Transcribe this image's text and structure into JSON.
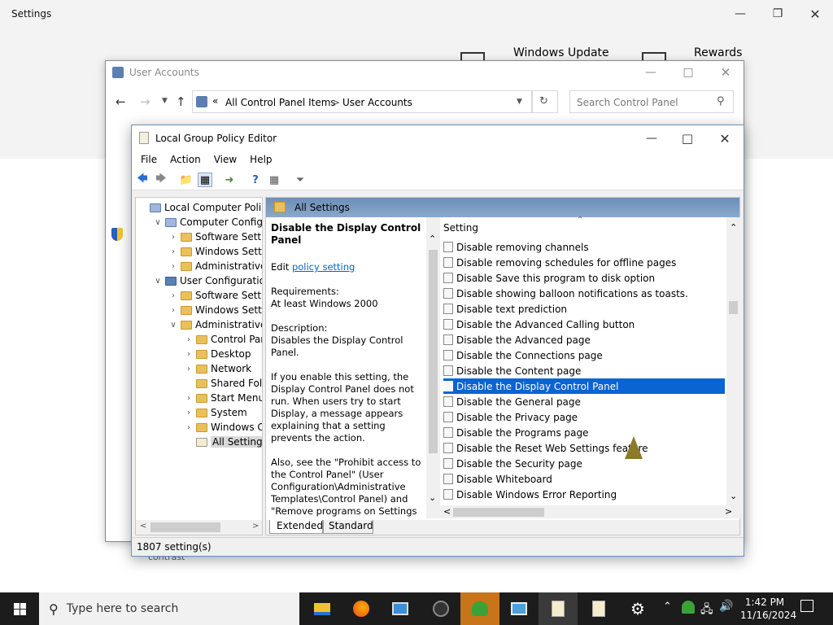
{
  "settings": {
    "title": "Settings",
    "tiles": [
      "Windows Update",
      "Rewards"
    ],
    "bottom_text": "contrast"
  },
  "user_accounts": {
    "title": "User Accounts",
    "breadcrumb": [
      "All Control Panel Items",
      "User Accounts"
    ],
    "breadcrumb_sep": ">",
    "breadcrumb_overflow": "«",
    "search_placeholder": "Search Control Panel"
  },
  "gpe": {
    "title": "Local Group Policy Editor",
    "menu": [
      "File",
      "Action",
      "View",
      "Help"
    ],
    "tree": [
      {
        "label": "Local Computer Policy",
        "indent": 0,
        "exp": "",
        "icon": "computer"
      },
      {
        "label": "Computer Configura",
        "indent": 1,
        "exp": "v",
        "icon": "computer"
      },
      {
        "label": "Software Settings",
        "indent": 2,
        "exp": ">",
        "icon": "folder"
      },
      {
        "label": "Windows Setting",
        "indent": 2,
        "exp": ">",
        "icon": "folder"
      },
      {
        "label": "Administrative Te",
        "indent": 2,
        "exp": ">",
        "icon": "folder"
      },
      {
        "label": "User Configuration",
        "indent": 1,
        "exp": "v",
        "icon": "user"
      },
      {
        "label": "Software Settings",
        "indent": 2,
        "exp": ">",
        "icon": "folder"
      },
      {
        "label": "Windows Setting",
        "indent": 2,
        "exp": ">",
        "icon": "folder"
      },
      {
        "label": "Administrative Te",
        "indent": 2,
        "exp": "v",
        "icon": "folder"
      },
      {
        "label": "Control Panel",
        "indent": 3,
        "exp": ">",
        "icon": "folder"
      },
      {
        "label": "Desktop",
        "indent": 3,
        "exp": ">",
        "icon": "folder"
      },
      {
        "label": "Network",
        "indent": 3,
        "exp": ">",
        "icon": "folder"
      },
      {
        "label": "Shared Folder",
        "indent": 3,
        "exp": "",
        "icon": "folder"
      },
      {
        "label": "Start Menu ar",
        "indent": 3,
        "exp": ">",
        "icon": "folder"
      },
      {
        "label": "System",
        "indent": 3,
        "exp": ">",
        "icon": "folder"
      },
      {
        "label": "Windows Cor",
        "indent": 3,
        "exp": ">",
        "icon": "folder"
      },
      {
        "label": "All Settings",
        "indent": 3,
        "exp": "",
        "icon": "settings",
        "selected": true
      }
    ],
    "pane_header": "All Settings",
    "desc": {
      "title": "Disable the Display Control Panel",
      "edit_prefix": "Edit ",
      "edit_link": "policy setting",
      "requirements_label": "Requirements:",
      "requirements": "At least Windows 2000",
      "description_label": "Description:",
      "description": "Disables the Display Control Panel.",
      "para1": "If you enable this setting, the Display Control Panel does not run. When users try to start Display, a message appears explaining that a setting prevents the action.",
      "para2": "Also, see the \"Prohibit access to the Control Panel\" (User Configuration\\Administrative Templates\\Control Panel) and \"Remove programs on Settings menu\" (User Configuration\\Administrative"
    },
    "list_header": "Setting",
    "settings_list": [
      "Disable removing channels",
      "Disable removing schedules for offline pages",
      "Disable Save this program to disk option",
      "Disable showing balloon notifications as toasts.",
      "Disable text prediction",
      "Disable the Advanced Calling button",
      "Disable the Advanced page",
      "Disable the Connections page",
      "Disable the Content page",
      "Disable the Display Control Panel",
      "Disable the General page",
      "Disable the Privacy page",
      "Disable the Programs page",
      "Disable the Reset Web Settings feature",
      "Disable the Security page",
      "Disable Whiteboard",
      "Disable Windows Error Reporting"
    ],
    "selected_index": 9,
    "tabs": [
      "Extended",
      "Standard"
    ],
    "status": "1807 setting(s)"
  },
  "taskbar": {
    "search_placeholder": "Type here to search",
    "time": "1:42 PM",
    "date": "11/16/2024"
  }
}
